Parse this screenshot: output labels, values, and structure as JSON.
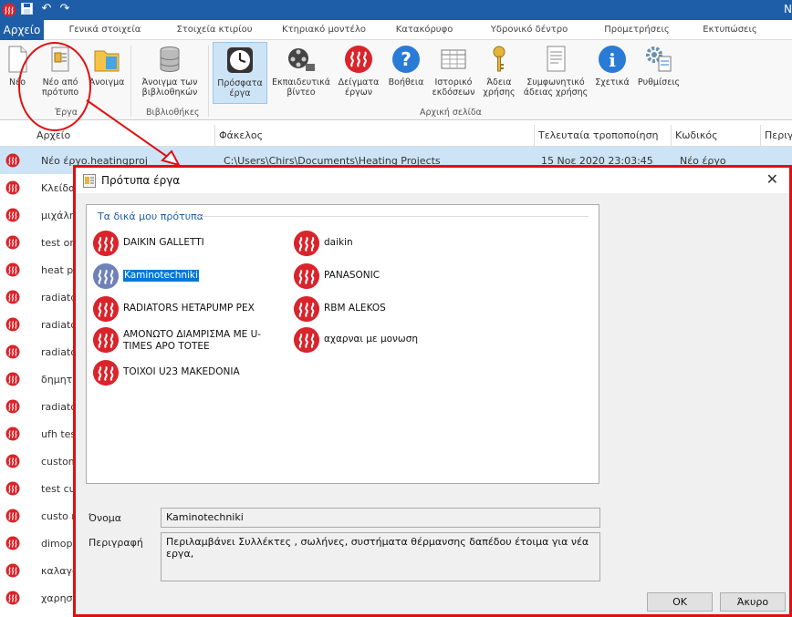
{
  "window": {
    "title_fragment": "N"
  },
  "tabs": {
    "file": "Αρχείο",
    "items": [
      "Γενικά στοιχεία",
      "Στοιχεία κτιρίου",
      "Κτηριακό μοντέλο",
      "Κατακόρυφο",
      "Υδρονικό δέντρο",
      "Προμετρήσεις",
      "Εκτυπώσεις"
    ]
  },
  "ribbon": {
    "buttons": [
      {
        "l1": "Νέο",
        "l2": "",
        "icon": "new-document-icon"
      },
      {
        "l1": "Νέο από",
        "l2": "πρότυπο",
        "icon": "template-icon"
      },
      {
        "l1": "Άνοιγμα",
        "l2": "",
        "icon": "open-folder-icon"
      },
      {
        "l1": "Άνοιγμα των",
        "l2": "βιβλιοθηκών",
        "icon": "database-icon"
      },
      {
        "l1": "Πρόσφατα",
        "l2": "έργα",
        "icon": "clock-icon"
      },
      {
        "l1": "Εκπαιδευτικά",
        "l2": "βίντεο",
        "icon": "film-reel-icon"
      },
      {
        "l1": "Δείγματα",
        "l2": "έργων",
        "icon": "heating-logo-icon"
      },
      {
        "l1": "Βοήθεια",
        "l2": "",
        "icon": "help-icon"
      },
      {
        "l1": "Ιστορικό",
        "l2": "εκδόσεων",
        "icon": "history-table-icon"
      },
      {
        "l1": "Άδεια",
        "l2": "χρήσης",
        "icon": "key-icon"
      },
      {
        "l1": "Συμφωνητικό",
        "l2": "άδειας χρήσης",
        "icon": "license-document-icon"
      },
      {
        "l1": "Σχετικά",
        "l2": "",
        "icon": "info-icon"
      },
      {
        "l1": "Ρυθμίσεις",
        "l2": "",
        "icon": "settings-icon"
      }
    ],
    "groups": {
      "projects": "Έργα",
      "libraries": "Βιβλιοθήκες",
      "home": "Αρχική σελίδα"
    }
  },
  "grid": {
    "headers": {
      "file": "Αρχείο",
      "folder": "Φάκελος",
      "modified": "Τελευταία τροποποίηση",
      "code": "Κωδικός",
      "desc": "Περιγ"
    },
    "rows": [
      {
        "name": "Νέο έργο.heatingproj",
        "folder": "C:\\Users\\Chirs\\Documents\\Heating Projects",
        "date": "15 Νοε 2020 23:03:45",
        "code": "Νέο έργο"
      },
      {
        "name": "Κλείδα",
        "folder": "",
        "date": "",
        "code": ""
      },
      {
        "name": "μιχάλης",
        "folder": "",
        "date": "",
        "code": ""
      },
      {
        "name": "test on",
        "folder": "",
        "date": "",
        "code": ""
      },
      {
        "name": "heat pu",
        "folder": "",
        "date": "",
        "code": ""
      },
      {
        "name": "radiato",
        "folder": "",
        "date": "",
        "code": ""
      },
      {
        "name": "radiato",
        "folder": "",
        "date": "",
        "code": ""
      },
      {
        "name": "radiato",
        "folder": "",
        "date": "",
        "code": ""
      },
      {
        "name": "δημητρ",
        "folder": "",
        "date": "",
        "code": ""
      },
      {
        "name": "radiato",
        "folder": "",
        "date": "",
        "code": ""
      },
      {
        "name": "ufh test",
        "folder": "",
        "date": "",
        "code": ""
      },
      {
        "name": "custom",
        "folder": "",
        "date": "",
        "code": ""
      },
      {
        "name": "test cus",
        "folder": "",
        "date": "",
        "code": ""
      },
      {
        "name": "custo n",
        "folder": "",
        "date": "",
        "code": ""
      },
      {
        "name": "dimopo",
        "folder": "",
        "date": "",
        "code": ""
      },
      {
        "name": "καλαγο",
        "folder": "",
        "date": "",
        "code": ""
      },
      {
        "name": "χαρησι",
        "folder": "",
        "date": "",
        "code": ""
      }
    ]
  },
  "dialog": {
    "title": "Πρότυπα έργα",
    "group_title": "Τα δικά μου πρότυπα",
    "templates_left": [
      {
        "label": "DAIKIN GALLETTI",
        "selected": false
      },
      {
        "label": "Kaminotechniki",
        "selected": true
      },
      {
        "label": "RADIATORS HETAPUMP PEX",
        "selected": false
      },
      {
        "label": "ΑΜΟΝΩΤΟ ΔΙΑΜΡΙΣΜΑ ΜΕ U-TIMES APO TOTEE",
        "selected": false
      },
      {
        "label": "TOIXOI U23 MAKEDONIA",
        "selected": false
      }
    ],
    "templates_right": [
      {
        "label": "daikin"
      },
      {
        "label": "PANASONIC"
      },
      {
        "label": "RBM ALEKOS"
      },
      {
        "label": "αχαρναι με μονωση"
      }
    ],
    "name_label": "Όνομα",
    "name_value": "Kaminotechniki",
    "desc_label": "Περιγραφή",
    "desc_value": "Περιλαμβάνει Συλλέκτες , σωλήνες, συστήματα θέρμανσης δαπέδου έτοιμα για νέα εργα,",
    "ok": "OK",
    "cancel": "Άκυρο"
  },
  "colors": {
    "accent": "#1e5ea8",
    "selection": "#cde4f7",
    "annotation": "#e01010",
    "logo": "#d9242b"
  }
}
